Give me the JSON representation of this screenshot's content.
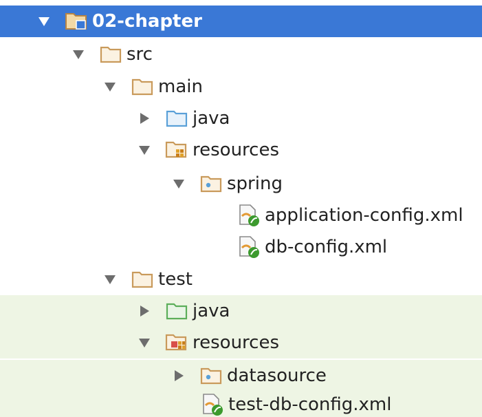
{
  "tree": {
    "root": {
      "label": "02-chapter"
    },
    "src": {
      "label": "src"
    },
    "main": {
      "label": "main"
    },
    "main_java": {
      "label": "java"
    },
    "main_resources": {
      "label": "resources"
    },
    "spring": {
      "label": "spring"
    },
    "application_config": {
      "label": "application-config.xml"
    },
    "db_config": {
      "label": "db-config.xml"
    },
    "test": {
      "label": "test"
    },
    "test_java": {
      "label": "java"
    },
    "test_resources": {
      "label": "resources"
    },
    "datasource": {
      "label": "datasource"
    },
    "test_db_config": {
      "label": "test-db-config.xml"
    }
  },
  "colors": {
    "selection": "#3a78d6",
    "test_background": "#eef5e4",
    "folder": "#c99a5b",
    "source_folder": "#5aa0d8",
    "test_source_folder": "#5cae5a",
    "xml_leaf": "#3c9a2e"
  },
  "icons": {
    "expanded": "triangle-down-icon",
    "collapsed": "triangle-right-icon",
    "folder": "folder-icon",
    "module": "module-folder-icon",
    "source_root": "source-folder-icon",
    "resources_root": "resources-folder-icon",
    "test_source_root": "test-source-folder-icon",
    "test_resources_root": "test-resources-folder-icon",
    "package": "package-folder-icon",
    "spring_xml": "spring-xml-file-icon"
  }
}
